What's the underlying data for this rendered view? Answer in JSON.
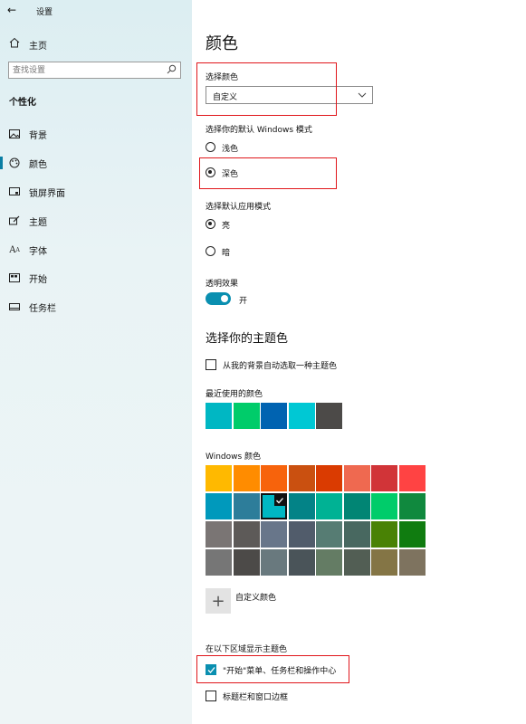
{
  "window": {
    "title": "设置"
  },
  "sidebar": {
    "home": "主页",
    "search_placeholder": "查找设置",
    "section": "个性化",
    "items": [
      {
        "label": "背景",
        "icon": "picture-icon"
      },
      {
        "label": "颜色",
        "icon": "palette-icon",
        "selected": true
      },
      {
        "label": "锁屏界面",
        "icon": "lock-screen-icon"
      },
      {
        "label": "主题",
        "icon": "brush-icon"
      },
      {
        "label": "字体",
        "icon": "font-icon"
      },
      {
        "label": "开始",
        "icon": "start-icon"
      },
      {
        "label": "任务栏",
        "icon": "taskbar-icon"
      }
    ]
  },
  "main": {
    "title": "颜色",
    "choose_color": {
      "label": "选择颜色",
      "value": "自定义"
    },
    "windows_mode": {
      "label": "选择你的默认 Windows 模式",
      "options": [
        "浅色",
        "深色"
      ],
      "selected": "深色"
    },
    "app_mode": {
      "label": "选择默认应用模式",
      "options": [
        "亮",
        "暗"
      ],
      "selected": "亮"
    },
    "transparency": {
      "label": "透明效果",
      "state": "开",
      "on": true
    },
    "accent": {
      "heading": "选择你的主题色",
      "auto_pick": "从我的背景自动选取一种主题色",
      "recent_label": "最近使用的颜色",
      "recent": [
        "#00b7c3",
        "#00cc6a",
        "#0063b1",
        "#00c8d4",
        "#4c4a48"
      ],
      "windows_label": "Windows 颜色",
      "windows_colors": [
        [
          "#ffb900",
          "#ff8c00",
          "#f7630c",
          "#ca5010",
          "#da3b01",
          "#ef6950",
          "#d13438",
          "#ff4343"
        ],
        [
          "#0099bc",
          "#2d7d9a",
          "#00b7c3",
          "#038387",
          "#00b294",
          "#018574",
          "#00cc6a",
          "#10893e"
        ],
        [
          "#7a7574",
          "#5d5a58",
          "#68768a",
          "#515c6b",
          "#567c73",
          "#486860",
          "#498205",
          "#107c10"
        ],
        [
          "#767676",
          "#4c4a48",
          "#69797e",
          "#4a5459",
          "#647c64",
          "#525e54",
          "#847545",
          "#7e735f"
        ]
      ],
      "selected_color": "#00b7c3",
      "custom": "自定义颜色"
    },
    "show_accent": {
      "label": "在以下区域显示主题色",
      "start_taskbar": {
        "label": "\"开始\"菜单、任务栏和操作中心",
        "checked": true
      },
      "title_bars": {
        "label": "标题栏和窗口边框",
        "checked": false
      }
    },
    "highlight_color": "#e0161b"
  }
}
